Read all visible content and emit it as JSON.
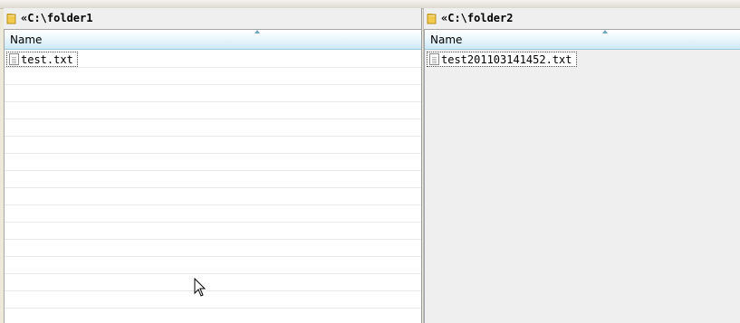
{
  "left_pane": {
    "path": "«C:\\folder1",
    "column_header": "Name",
    "files": [
      "test.txt"
    ]
  },
  "right_pane": {
    "path": "«C:\\folder2",
    "column_header": "Name",
    "files": [
      "test201103141452.txt"
    ]
  },
  "colors": {
    "header_gradient_bottom": "#cde9f6",
    "folder_yellow": "#f2c94c",
    "pane_background": "#efefef"
  },
  "icons": [
    "folder-icon",
    "file-icon",
    "sort-ascending-icon",
    "mouse-cursor"
  ]
}
